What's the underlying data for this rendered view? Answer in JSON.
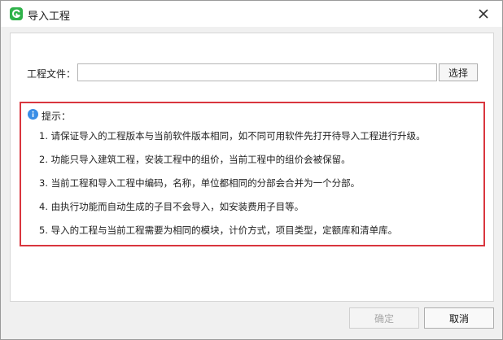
{
  "window": {
    "title": "导入工程",
    "app_icon": "app-logo-icon",
    "close_icon": "close-icon"
  },
  "file": {
    "label": "工程文件：",
    "value": "",
    "placeholder": "",
    "select_label": "选择"
  },
  "hint": {
    "icon": "info-icon",
    "title": "提示：",
    "items": [
      "1. 请保证导入的工程版本与当前软件版本相同，如不同可用软件先打开待导入工程进行升级。",
      "2. 功能只导入建筑工程，安装工程中的组价，当前工程中的组价会被保留。",
      "3. 当前工程和导入工程中编码，名称，单位都相同的分部会合并为一个分部。",
      "4. 由执行功能而自动生成的子目不会导入，如安装费用子目等。",
      "5. 导入的工程与当前工程需要为相同的模块，计价方式，项目类型，定额库和清单库。"
    ],
    "border_color": "#d9363e"
  },
  "footer": {
    "ok_label": "确定",
    "ok_enabled": false,
    "cancel_label": "取消"
  },
  "colors": {
    "app_icon": "#2fb24a",
    "info_icon": "#3a8ee6"
  }
}
